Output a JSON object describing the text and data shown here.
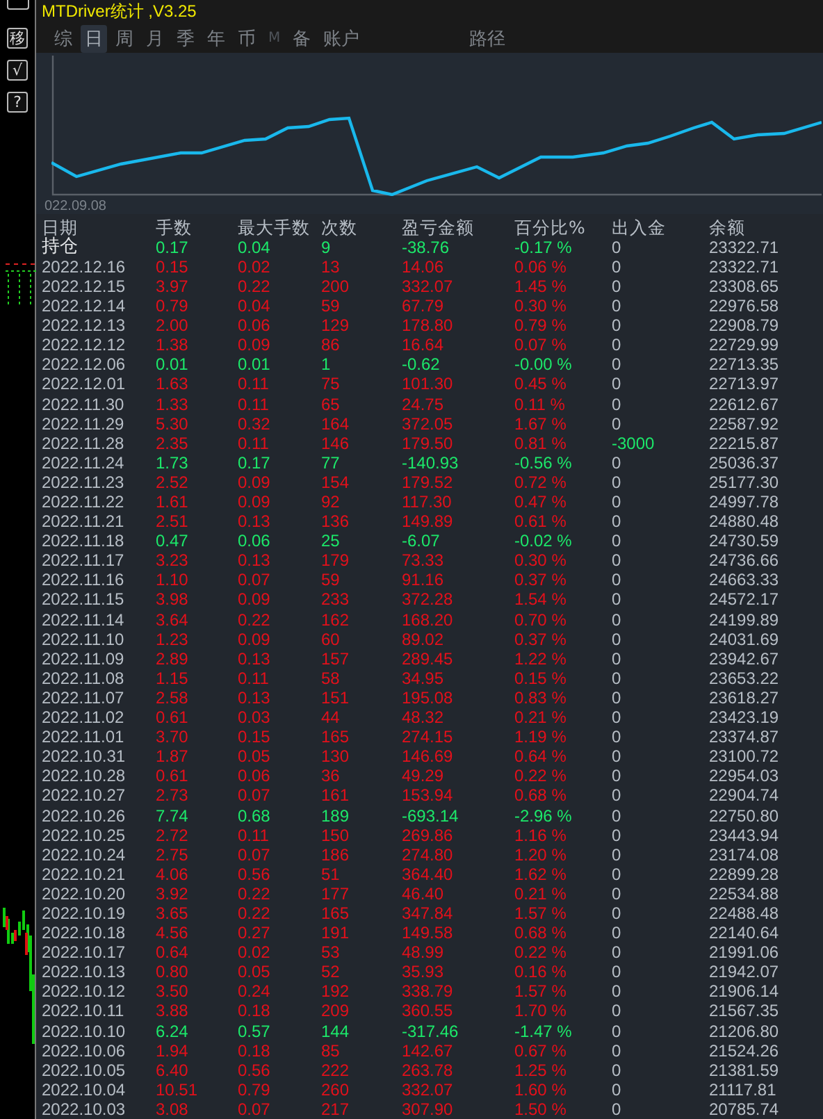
{
  "side_buttons": [
    {
      "label": "移"
    },
    {
      "label": "√"
    },
    {
      "label": "?"
    }
  ],
  "window": {
    "title": "MTDriver统计 ,V3.25"
  },
  "tabs": [
    {
      "label": "综",
      "selected": false,
      "disabled": false
    },
    {
      "label": "日",
      "selected": true,
      "disabled": false
    },
    {
      "label": "周",
      "selected": false,
      "disabled": false
    },
    {
      "label": "月",
      "selected": false,
      "disabled": false
    },
    {
      "label": "季",
      "selected": false,
      "disabled": false
    },
    {
      "label": "年",
      "selected": false,
      "disabled": false
    },
    {
      "label": "币",
      "selected": false,
      "disabled": false
    },
    {
      "label": "M",
      "selected": false,
      "disabled": true
    },
    {
      "label": "备",
      "selected": false,
      "disabled": false
    },
    {
      "label": "账户",
      "selected": false,
      "disabled": false
    }
  ],
  "path_tab": {
    "label": "路径"
  },
  "balance_chart": {
    "start_label": "022.09.08"
  },
  "table": {
    "columns": [
      "日期",
      "手数",
      "最大手数",
      "次数",
      "盈亏金额",
      "百分比%",
      "出入金",
      "余额"
    ],
    "rows": [
      {
        "date": "持仓",
        "lots": "0.17",
        "max_lots": "0.04",
        "count": "9",
        "pnl": "-38.76",
        "pct": "-0.17 %",
        "deposit": "0",
        "balance": "23322.71",
        "kind": "loss",
        "deposit_highlight": false
      },
      {
        "date": "2022.12.16",
        "lots": "0.15",
        "max_lots": "0.02",
        "count": "13",
        "pnl": "14.06",
        "pct": "0.06 %",
        "deposit": "0",
        "balance": "23322.71",
        "kind": "profit",
        "deposit_highlight": false
      },
      {
        "date": "2022.12.15",
        "lots": "3.97",
        "max_lots": "0.22",
        "count": "200",
        "pnl": "332.07",
        "pct": "1.45 %",
        "deposit": "0",
        "balance": "23308.65",
        "kind": "profit",
        "deposit_highlight": false
      },
      {
        "date": "2022.12.14",
        "lots": "0.79",
        "max_lots": "0.04",
        "count": "59",
        "pnl": "67.79",
        "pct": "0.30 %",
        "deposit": "0",
        "balance": "22976.58",
        "kind": "profit",
        "deposit_highlight": false
      },
      {
        "date": "2022.12.13",
        "lots": "2.00",
        "max_lots": "0.06",
        "count": "129",
        "pnl": "178.80",
        "pct": "0.79 %",
        "deposit": "0",
        "balance": "22908.79",
        "kind": "profit",
        "deposit_highlight": false
      },
      {
        "date": "2022.12.12",
        "lots": "1.38",
        "max_lots": "0.09",
        "count": "86",
        "pnl": "16.64",
        "pct": "0.07 %",
        "deposit": "0",
        "balance": "22729.99",
        "kind": "profit",
        "deposit_highlight": false
      },
      {
        "date": "2022.12.06",
        "lots": "0.01",
        "max_lots": "0.01",
        "count": "1",
        "pnl": "-0.62",
        "pct": "-0.00 %",
        "deposit": "0",
        "balance": "22713.35",
        "kind": "loss",
        "deposit_highlight": false
      },
      {
        "date": "2022.12.01",
        "lots": "1.63",
        "max_lots": "0.11",
        "count": "75",
        "pnl": "101.30",
        "pct": "0.45 %",
        "deposit": "0",
        "balance": "22713.97",
        "kind": "profit",
        "deposit_highlight": false
      },
      {
        "date": "2022.11.30",
        "lots": "1.33",
        "max_lots": "0.11",
        "count": "65",
        "pnl": "24.75",
        "pct": "0.11 %",
        "deposit": "0",
        "balance": "22612.67",
        "kind": "profit",
        "deposit_highlight": false
      },
      {
        "date": "2022.11.29",
        "lots": "5.30",
        "max_lots": "0.32",
        "count": "164",
        "pnl": "372.05",
        "pct": "1.67 %",
        "deposit": "0",
        "balance": "22587.92",
        "kind": "profit",
        "deposit_highlight": false
      },
      {
        "date": "2022.11.28",
        "lots": "2.35",
        "max_lots": "0.11",
        "count": "146",
        "pnl": "179.50",
        "pct": "0.81 %",
        "deposit": "-3000",
        "balance": "22215.87",
        "kind": "profit",
        "deposit_highlight": true
      },
      {
        "date": "2022.11.24",
        "lots": "1.73",
        "max_lots": "0.17",
        "count": "77",
        "pnl": "-140.93",
        "pct": "-0.56 %",
        "deposit": "0",
        "balance": "25036.37",
        "kind": "loss",
        "deposit_highlight": false
      },
      {
        "date": "2022.11.23",
        "lots": "2.52",
        "max_lots": "0.09",
        "count": "154",
        "pnl": "179.52",
        "pct": "0.72 %",
        "deposit": "0",
        "balance": "25177.30",
        "kind": "profit",
        "deposit_highlight": false
      },
      {
        "date": "2022.11.22",
        "lots": "1.61",
        "max_lots": "0.09",
        "count": "92",
        "pnl": "117.30",
        "pct": "0.47 %",
        "deposit": "0",
        "balance": "24997.78",
        "kind": "profit",
        "deposit_highlight": false
      },
      {
        "date": "2022.11.21",
        "lots": "2.51",
        "max_lots": "0.13",
        "count": "136",
        "pnl": "149.89",
        "pct": "0.61 %",
        "deposit": "0",
        "balance": "24880.48",
        "kind": "profit",
        "deposit_highlight": false
      },
      {
        "date": "2022.11.18",
        "lots": "0.47",
        "max_lots": "0.06",
        "count": "25",
        "pnl": "-6.07",
        "pct": "-0.02 %",
        "deposit": "0",
        "balance": "24730.59",
        "kind": "loss",
        "deposit_highlight": false
      },
      {
        "date": "2022.11.17",
        "lots": "3.23",
        "max_lots": "0.13",
        "count": "179",
        "pnl": "73.33",
        "pct": "0.30 %",
        "deposit": "0",
        "balance": "24736.66",
        "kind": "profit",
        "deposit_highlight": false
      },
      {
        "date": "2022.11.16",
        "lots": "1.10",
        "max_lots": "0.07",
        "count": "59",
        "pnl": "91.16",
        "pct": "0.37 %",
        "deposit": "0",
        "balance": "24663.33",
        "kind": "profit",
        "deposit_highlight": false
      },
      {
        "date": "2022.11.15",
        "lots": "3.98",
        "max_lots": "0.09",
        "count": "233",
        "pnl": "372.28",
        "pct": "1.54 %",
        "deposit": "0",
        "balance": "24572.17",
        "kind": "profit",
        "deposit_highlight": false
      },
      {
        "date": "2022.11.14",
        "lots": "3.64",
        "max_lots": "0.22",
        "count": "162",
        "pnl": "168.20",
        "pct": "0.70 %",
        "deposit": "0",
        "balance": "24199.89",
        "kind": "profit",
        "deposit_highlight": false
      },
      {
        "date": "2022.11.10",
        "lots": "1.23",
        "max_lots": "0.09",
        "count": "60",
        "pnl": "89.02",
        "pct": "0.37 %",
        "deposit": "0",
        "balance": "24031.69",
        "kind": "profit",
        "deposit_highlight": false
      },
      {
        "date": "2022.11.09",
        "lots": "2.89",
        "max_lots": "0.13",
        "count": "157",
        "pnl": "289.45",
        "pct": "1.22 %",
        "deposit": "0",
        "balance": "23942.67",
        "kind": "profit",
        "deposit_highlight": false
      },
      {
        "date": "2022.11.08",
        "lots": "1.15",
        "max_lots": "0.11",
        "count": "58",
        "pnl": "34.95",
        "pct": "0.15 %",
        "deposit": "0",
        "balance": "23653.22",
        "kind": "profit",
        "deposit_highlight": false
      },
      {
        "date": "2022.11.07",
        "lots": "2.58",
        "max_lots": "0.13",
        "count": "151",
        "pnl": "195.08",
        "pct": "0.83 %",
        "deposit": "0",
        "balance": "23618.27",
        "kind": "profit",
        "deposit_highlight": false
      },
      {
        "date": "2022.11.02",
        "lots": "0.61",
        "max_lots": "0.03",
        "count": "44",
        "pnl": "48.32",
        "pct": "0.21 %",
        "deposit": "0",
        "balance": "23423.19",
        "kind": "profit",
        "deposit_highlight": false
      },
      {
        "date": "2022.11.01",
        "lots": "3.70",
        "max_lots": "0.15",
        "count": "165",
        "pnl": "274.15",
        "pct": "1.19 %",
        "deposit": "0",
        "balance": "23374.87",
        "kind": "profit",
        "deposit_highlight": false
      },
      {
        "date": "2022.10.31",
        "lots": "1.87",
        "max_lots": "0.05",
        "count": "130",
        "pnl": "146.69",
        "pct": "0.64 %",
        "deposit": "0",
        "balance": "23100.72",
        "kind": "profit",
        "deposit_highlight": false
      },
      {
        "date": "2022.10.28",
        "lots": "0.61",
        "max_lots": "0.06",
        "count": "36",
        "pnl": "49.29",
        "pct": "0.22 %",
        "deposit": "0",
        "balance": "22954.03",
        "kind": "profit",
        "deposit_highlight": false
      },
      {
        "date": "2022.10.27",
        "lots": "2.73",
        "max_lots": "0.07",
        "count": "161",
        "pnl": "153.94",
        "pct": "0.68 %",
        "deposit": "0",
        "balance": "22904.74",
        "kind": "profit",
        "deposit_highlight": false
      },
      {
        "date": "2022.10.26",
        "lots": "7.74",
        "max_lots": "0.68",
        "count": "189",
        "pnl": "-693.14",
        "pct": "-2.96 %",
        "deposit": "0",
        "balance": "22750.80",
        "kind": "loss",
        "deposit_highlight": false
      },
      {
        "date": "2022.10.25",
        "lots": "2.72",
        "max_lots": "0.11",
        "count": "150",
        "pnl": "269.86",
        "pct": "1.16 %",
        "deposit": "0",
        "balance": "23443.94",
        "kind": "profit",
        "deposit_highlight": false
      },
      {
        "date": "2022.10.24",
        "lots": "2.75",
        "max_lots": "0.07",
        "count": "186",
        "pnl": "274.80",
        "pct": "1.20 %",
        "deposit": "0",
        "balance": "23174.08",
        "kind": "profit",
        "deposit_highlight": false
      },
      {
        "date": "2022.10.21",
        "lots": "4.06",
        "max_lots": "0.56",
        "count": "51",
        "pnl": "364.40",
        "pct": "1.62 %",
        "deposit": "0",
        "balance": "22899.28",
        "kind": "profit",
        "deposit_highlight": false
      },
      {
        "date": "2022.10.20",
        "lots": "3.92",
        "max_lots": "0.22",
        "count": "177",
        "pnl": "46.40",
        "pct": "0.21 %",
        "deposit": "0",
        "balance": "22534.88",
        "kind": "profit",
        "deposit_highlight": false
      },
      {
        "date": "2022.10.19",
        "lots": "3.65",
        "max_lots": "0.22",
        "count": "165",
        "pnl": "347.84",
        "pct": "1.57 %",
        "deposit": "0",
        "balance": "22488.48",
        "kind": "profit",
        "deposit_highlight": false
      },
      {
        "date": "2022.10.18",
        "lots": "4.56",
        "max_lots": "0.27",
        "count": "191",
        "pnl": "149.58",
        "pct": "0.68 %",
        "deposit": "0",
        "balance": "22140.64",
        "kind": "profit",
        "deposit_highlight": false
      },
      {
        "date": "2022.10.17",
        "lots": "0.64",
        "max_lots": "0.02",
        "count": "53",
        "pnl": "48.99",
        "pct": "0.22 %",
        "deposit": "0",
        "balance": "21991.06",
        "kind": "profit",
        "deposit_highlight": false
      },
      {
        "date": "2022.10.13",
        "lots": "0.80",
        "max_lots": "0.05",
        "count": "52",
        "pnl": "35.93",
        "pct": "0.16 %",
        "deposit": "0",
        "balance": "21942.07",
        "kind": "profit",
        "deposit_highlight": false
      },
      {
        "date": "2022.10.12",
        "lots": "3.50",
        "max_lots": "0.24",
        "count": "192",
        "pnl": "338.79",
        "pct": "1.57 %",
        "deposit": "0",
        "balance": "21906.14",
        "kind": "profit",
        "deposit_highlight": false
      },
      {
        "date": "2022.10.11",
        "lots": "3.88",
        "max_lots": "0.18",
        "count": "209",
        "pnl": "360.55",
        "pct": "1.70 %",
        "deposit": "0",
        "balance": "21567.35",
        "kind": "profit",
        "deposit_highlight": false
      },
      {
        "date": "2022.10.10",
        "lots": "6.24",
        "max_lots": "0.57",
        "count": "144",
        "pnl": "-317.46",
        "pct": "-1.47 %",
        "deposit": "0",
        "balance": "21206.80",
        "kind": "loss",
        "deposit_highlight": false
      },
      {
        "date": "2022.10.06",
        "lots": "1.94",
        "max_lots": "0.18",
        "count": "85",
        "pnl": "142.67",
        "pct": "0.67 %",
        "deposit": "0",
        "balance": "21524.26",
        "kind": "profit",
        "deposit_highlight": false
      },
      {
        "date": "2022.10.05",
        "lots": "6.40",
        "max_lots": "0.56",
        "count": "222",
        "pnl": "263.78",
        "pct": "1.25 %",
        "deposit": "0",
        "balance": "21381.59",
        "kind": "profit",
        "deposit_highlight": false
      },
      {
        "date": "2022.10.04",
        "lots": "10.51",
        "max_lots": "0.79",
        "count": "260",
        "pnl": "332.07",
        "pct": "1.60 %",
        "deposit": "0",
        "balance": "21117.81",
        "kind": "profit",
        "deposit_highlight": false
      },
      {
        "date": "2022.10.03",
        "lots": "3.08",
        "max_lots": "0.07",
        "count": "217",
        "pnl": "307.90",
        "pct": "1.50 %",
        "deposit": "0",
        "balance": "20785.74",
        "kind": "profit",
        "deposit_highlight": false
      }
    ]
  }
}
